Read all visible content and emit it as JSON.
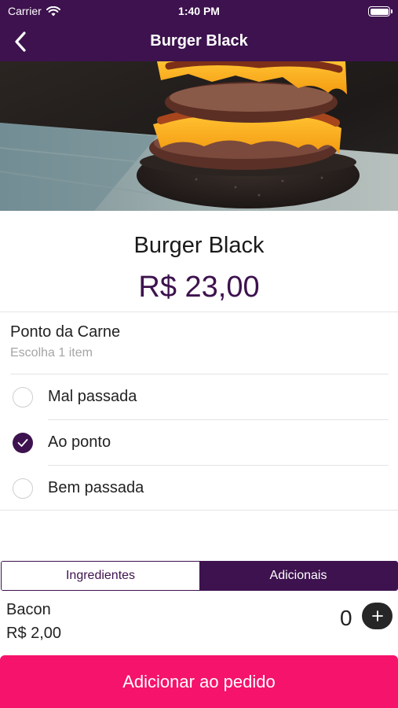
{
  "status_bar": {
    "carrier": "Carrier",
    "time": "1:40 PM"
  },
  "nav": {
    "title": "Burger Black",
    "back_icon": "chevron-left-icon"
  },
  "product": {
    "name": "Burger Black",
    "price": "R$ 23,00"
  },
  "options_group": {
    "title": "Ponto da Carne",
    "subtitle": "Escolha 1 item",
    "items": [
      {
        "label": "Mal passada",
        "selected": false
      },
      {
        "label": "Ao ponto",
        "selected": true
      },
      {
        "label": "Bem passada",
        "selected": false
      }
    ]
  },
  "tabs": [
    {
      "label": "Ingredientes",
      "active": false
    },
    {
      "label": "Adicionais",
      "active": true
    }
  ],
  "extras": [
    {
      "name": "Bacon",
      "price": "R$ 2,00",
      "quantity": "0"
    }
  ],
  "cta": {
    "label": "Adicionar ao pedido"
  },
  "colors": {
    "primary": "#3d124e",
    "accent": "#f5136c"
  }
}
